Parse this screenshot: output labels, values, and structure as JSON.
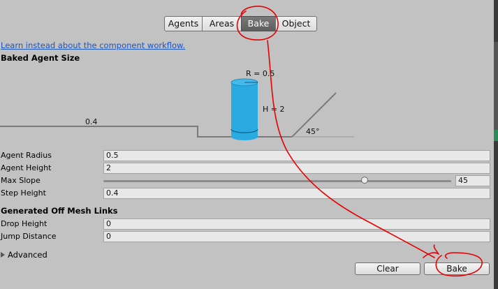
{
  "tabs": [
    {
      "label": "Agents",
      "active": false
    },
    {
      "label": "Areas",
      "active": false
    },
    {
      "label": "Bake",
      "active": true
    },
    {
      "label": "Object",
      "active": false
    }
  ],
  "workflow_link": "Learn instead about the component workflow.",
  "baked_agent_size": {
    "title": "Baked Agent Size",
    "diagram": {
      "radius_label": "R = 0.5",
      "height_label": "H = 2",
      "step_label": "0.4",
      "slope_label": "45°"
    },
    "agent_radius": {
      "label": "Agent Radius",
      "value": "0.5"
    },
    "agent_height": {
      "label": "Agent Height",
      "value": "2"
    },
    "max_slope": {
      "label": "Max Slope",
      "value": "45",
      "slider_fraction": 0.75
    },
    "step_height": {
      "label": "Step Height",
      "value": "0.4"
    }
  },
  "off_mesh_links": {
    "title": "Generated Off Mesh Links",
    "drop_height": {
      "label": "Drop Height",
      "value": "0"
    },
    "jump_distance": {
      "label": "Jump Distance",
      "value": "0"
    }
  },
  "advanced": {
    "label": "Advanced",
    "expanded": false
  },
  "buttons": {
    "clear": "Clear",
    "bake": "Bake"
  },
  "colors": {
    "panel_bg": "#c2c2c2",
    "agent_cylinder": "#29abe2",
    "active_tab": "#6a6a6a",
    "link": "#1a55c9",
    "annotation": "#e60000"
  }
}
